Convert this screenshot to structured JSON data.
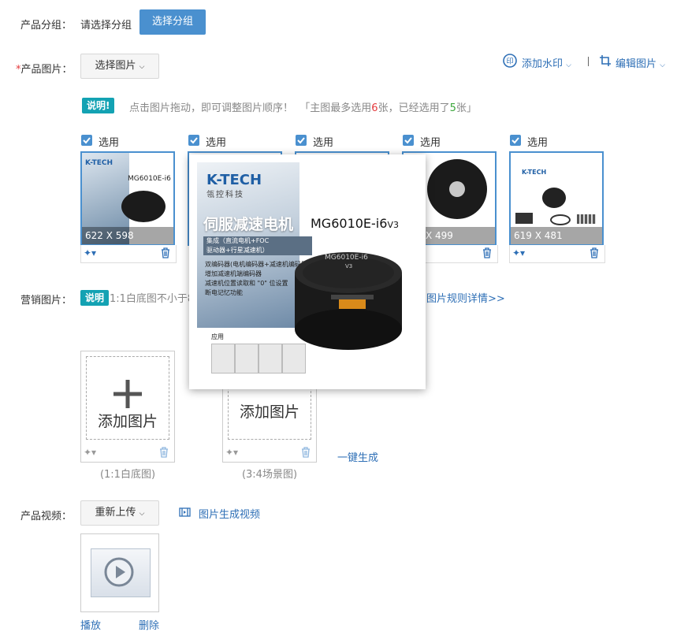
{
  "group": {
    "label": "产品分组：",
    "placeholder_text": "请选择分组",
    "select_button": "选择分组"
  },
  "product_images": {
    "required_mark": "*",
    "label": "产品图片：",
    "select_button": "选择图片",
    "watermark_label": "添加水印",
    "edit_label": "编辑图片",
    "notice_tag": "说明!",
    "notice_text": "点击图片拖动，即可调整图片顺序！",
    "limit_prefix": "「主图最多选用",
    "limit_max": "6",
    "limit_middle": "张，已经选用了",
    "limit_used": "5",
    "limit_suffix": "张」",
    "cards": [
      {
        "check_label": "选用",
        "dims": "622 X 598"
      },
      {
        "check_label": "选用",
        "dims": ""
      },
      {
        "check_label": "选用",
        "dims": ""
      },
      {
        "check_label": "选用",
        "dims": "X 499"
      },
      {
        "check_label": "选用",
        "dims": "619 X 481"
      }
    ]
  },
  "preview": {
    "brand": "K-TECH",
    "brand_cn": "瓴控科技",
    "headline": "伺服减速电机",
    "model_prefix": "MG6010E-i6",
    "model_version": "V3",
    "integ_line1": "集成（直流电机+FOC",
    "integ_line2": "驱动器+行星减速机）",
    "features": [
      "双编码器(电机编码器+减速机编码器)",
      "增加减速机端编码器",
      "减速机位置读取和 \"0\" 位设置",
      "断电记忆功能"
    ],
    "motor_label": "MG6010E-i6",
    "motor_label_v": "V3",
    "apps_label": "应用"
  },
  "marketing": {
    "label": "营销图片：",
    "tag": "说明",
    "text": "1:1白底图不小于8",
    "rules_link": "图片规则详情>>",
    "add_image": "添加图片",
    "add_image_2": "添加图片",
    "one_click": "一键生成",
    "caption_1": "(1:1白底图)",
    "caption_2": "(3:4场景图)"
  },
  "video": {
    "label": "产品视频：",
    "reupload": "重新上传",
    "gen_video": "图片生成视频",
    "play": "播放",
    "delete": "删除"
  },
  "colors": {
    "accent": "#4a90cf",
    "tag_teal": "#13a2b3",
    "link": "#2e6fb6",
    "required": "#e4393c"
  }
}
